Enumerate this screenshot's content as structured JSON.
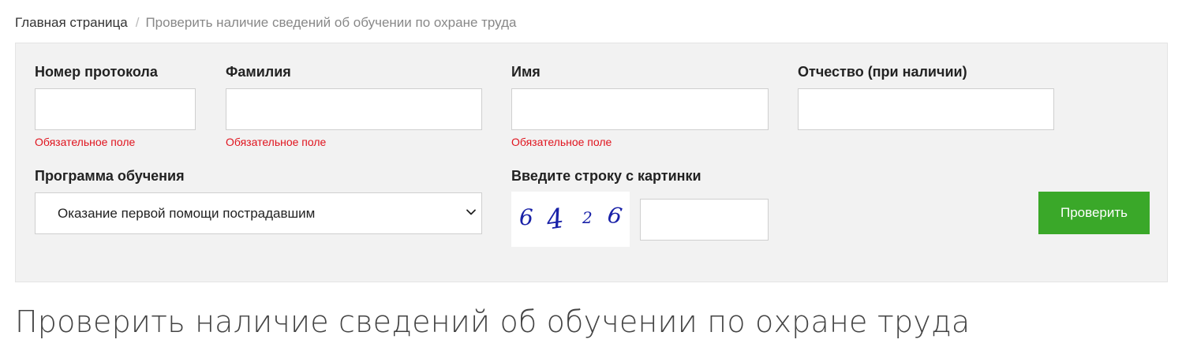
{
  "breadcrumb": {
    "home": "Главная страница",
    "separator": "/",
    "current": "Проверить наличие сведений об обучении по охране труда"
  },
  "form": {
    "protocol": {
      "label": "Номер протокола",
      "value": "",
      "error": "Обязательное поле"
    },
    "surname": {
      "label": "Фамилия",
      "value": "",
      "error": "Обязательное поле"
    },
    "name": {
      "label": "Имя",
      "value": "",
      "error": "Обязательное поле"
    },
    "patronymic": {
      "label": "Отчество (при наличии)",
      "value": ""
    },
    "program": {
      "label": "Программа обучения",
      "selected": "Оказание первой помощи пострадавшим"
    },
    "captcha": {
      "label": "Введите строку с картинки",
      "image_text": "6426",
      "value": ""
    },
    "submit_label": "Проверить"
  },
  "page_title": "Проверить наличие сведений об обучении по охране труда",
  "colors": {
    "panel_bg": "#f2f2f2",
    "error": "#e0141e",
    "button": "#3aa829",
    "captcha_ink": "#1a22a8"
  }
}
